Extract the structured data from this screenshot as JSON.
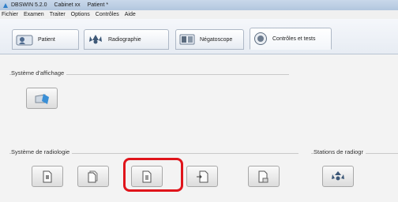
{
  "window": {
    "app_title": "DBSWIN 5.2.0",
    "cabinet": "Cabinet xx",
    "patient": "Patient *"
  },
  "menu": [
    "Fichier",
    "Examen",
    "Traiter",
    "Options",
    "Contrôles",
    "Aide"
  ],
  "tabs": [
    {
      "label": "Patient",
      "icon": "patient-icon"
    },
    {
      "label": "Radiographie",
      "icon": "xray-icon"
    },
    {
      "label": "Négatoscope",
      "icon": "negatoscope-icon"
    },
    {
      "label": "Contrôles et tests",
      "icon": "controls-icon",
      "active": true
    }
  ],
  "groups": {
    "display": {
      "label": "Système d'affichage"
    },
    "radiology": {
      "label": "Système de radiologie"
    },
    "stations": {
      "label": "Stations de radiogr"
    }
  },
  "colors": {
    "highlight": "#e0141b",
    "accent": "#3a8fd6"
  }
}
